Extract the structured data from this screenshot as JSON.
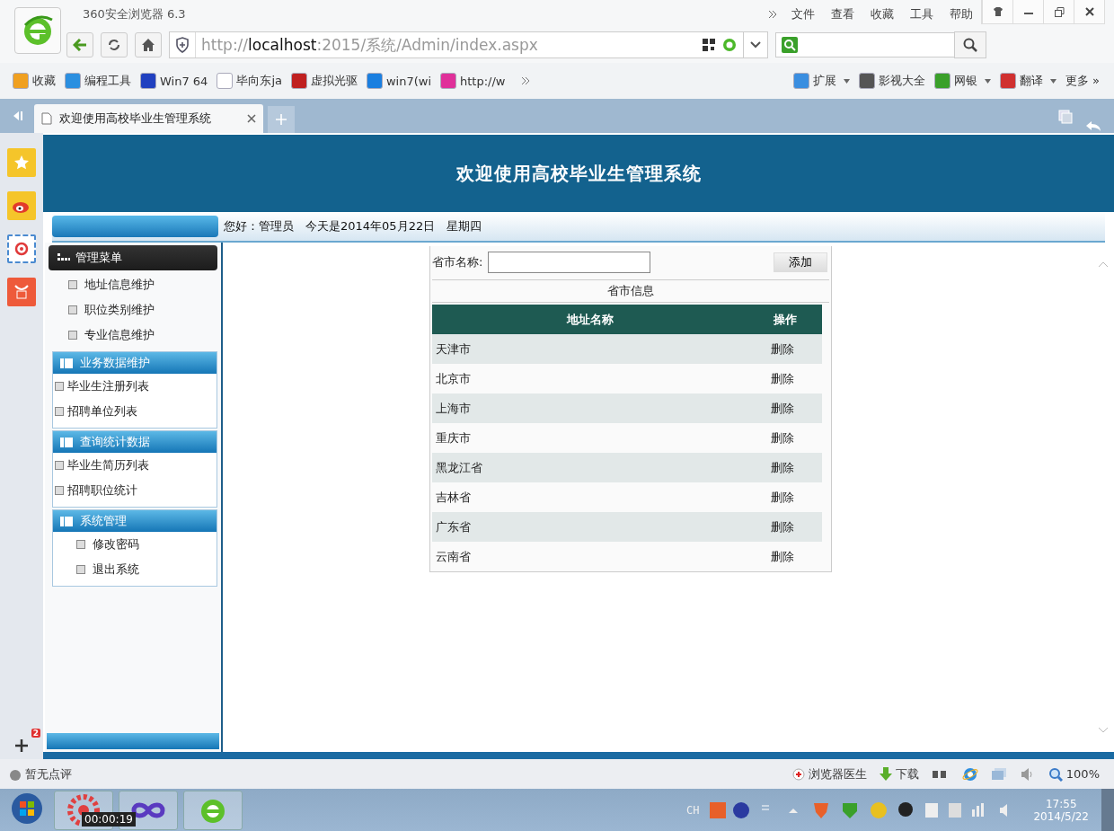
{
  "browser": {
    "title": "360安全浏览器 6.3",
    "menu": [
      "文件",
      "查看",
      "收藏",
      "工具",
      "帮助"
    ],
    "url": {
      "scheme": "http://",
      "host": "localhost",
      "rest": ":2015/系统/Admin/index.aspx"
    },
    "bookmarks": [
      {
        "label": "收藏",
        "kind": "fav"
      },
      {
        "label": "编程工具",
        "kind": "cloud"
      },
      {
        "label": "Win7 64",
        "kind": "paw"
      },
      {
        "label": "毕向东ja",
        "kind": "page"
      },
      {
        "label": "虚拟光驱",
        "kind": "hourglass"
      },
      {
        "label": "win7(wi",
        "kind": "circle"
      },
      {
        "label": "http://w",
        "kind": "heart"
      }
    ],
    "extras": [
      {
        "label": "扩展",
        "kind": "blocks",
        "dropdown": true
      },
      {
        "label": "影视大全",
        "kind": "play",
        "dropdown": false
      },
      {
        "label": "网银",
        "kind": "shield",
        "dropdown": true
      },
      {
        "label": "翻译",
        "kind": "translate",
        "dropdown": true
      },
      {
        "label": "更多 »",
        "kind": "none",
        "dropdown": false
      }
    ],
    "tab": {
      "title": "欢迎使用高校毕业生管理系统"
    }
  },
  "page": {
    "title": "欢迎使用高校毕业生管理系统",
    "greeting": "您好：管理员　今天是2014年05月22日　星期四",
    "menu_title": "管理菜单",
    "groups": [
      {
        "indent": true,
        "items": [
          "地址信息维护",
          "职位类别维护",
          "专业信息维护"
        ]
      },
      {
        "title": "业务数据维护",
        "indent": false,
        "items": [
          "毕业生注册列表",
          "招聘单位列表"
        ]
      },
      {
        "title": "查询统计数据",
        "indent": false,
        "items": [
          "毕业生简历列表",
          "招聘职位统计"
        ]
      },
      {
        "title": "系统管理",
        "indent": true,
        "items": [
          "修改密码",
          "退出系统"
        ]
      }
    ],
    "form": {
      "label": "省市名称:",
      "button": "添加"
    },
    "table": {
      "caption": "省市信息",
      "columns": [
        "地址名称",
        "操作"
      ],
      "rows": [
        {
          "name": "天津市",
          "action": "删除"
        },
        {
          "name": "北京市",
          "action": "删除"
        },
        {
          "name": "上海市",
          "action": "删除"
        },
        {
          "name": "重庆市",
          "action": "删除"
        },
        {
          "name": "黑龙江省",
          "action": "删除"
        },
        {
          "name": "吉林省",
          "action": "删除"
        },
        {
          "name": "广东省",
          "action": "删除"
        },
        {
          "name": "云南省",
          "action": "删除"
        }
      ]
    }
  },
  "rail_badge": "2",
  "status": {
    "review": "暂无点评",
    "doctor": "浏览器医生",
    "download": "下载",
    "zoom": "100%"
  },
  "taskbar": {
    "tooltip": "00:00:19",
    "lang": "CH",
    "time": "17:55",
    "date": "2014/5/22"
  }
}
